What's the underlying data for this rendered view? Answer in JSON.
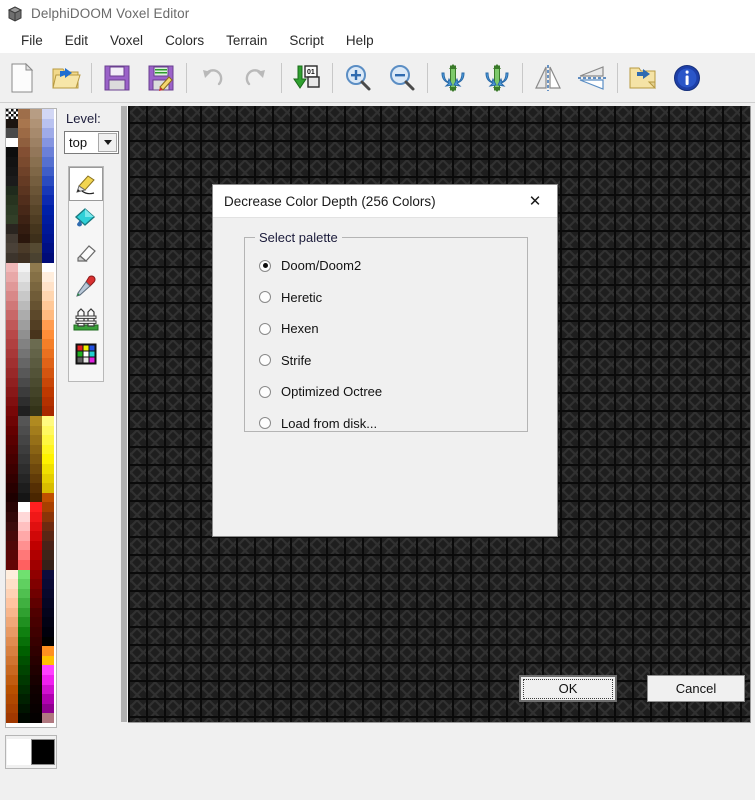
{
  "window": {
    "title": "DelphiDOOM Voxel Editor",
    "icon": "cube-icon"
  },
  "menubar": {
    "items": [
      {
        "label": "File"
      },
      {
        "label": "Edit"
      },
      {
        "label": "Voxel"
      },
      {
        "label": "Colors"
      },
      {
        "label": "Terrain"
      },
      {
        "label": "Script"
      },
      {
        "label": "Help"
      }
    ]
  },
  "toolbar": {
    "buttons": [
      {
        "name": "new-file-icon",
        "tooltip": "New"
      },
      {
        "name": "open-file-icon",
        "tooltip": "Open"
      },
      {
        "name": "save-icon",
        "tooltip": "Save"
      },
      {
        "name": "save-as-icon",
        "tooltip": "Save As"
      },
      {
        "name": "undo-icon",
        "tooltip": "Undo"
      },
      {
        "name": "redo-icon",
        "tooltip": "Redo"
      },
      {
        "name": "import-icon",
        "tooltip": "Import"
      },
      {
        "name": "zoom-in-icon",
        "tooltip": "Zoom In"
      },
      {
        "name": "zoom-out-icon",
        "tooltip": "Zoom Out"
      },
      {
        "name": "flip-vertical-icon",
        "tooltip": "Flip Vertical"
      },
      {
        "name": "rotate-vertical-icon",
        "tooltip": "Rotate Vertical"
      },
      {
        "name": "mirror-horizontal-icon",
        "tooltip": "Mirror Horizontal"
      },
      {
        "name": "mirror-vertical-icon",
        "tooltip": "Mirror Vertical"
      },
      {
        "name": "export-icon",
        "tooltip": "Export"
      },
      {
        "name": "info-icon",
        "tooltip": "About"
      }
    ]
  },
  "sidebar": {
    "level": {
      "label": "Level:",
      "value": "top",
      "options": [
        "top"
      ]
    },
    "tools": [
      {
        "name": "pencil-tool",
        "selected": true
      },
      {
        "name": "fill-tool",
        "selected": false
      },
      {
        "name": "eraser-tool",
        "selected": false
      },
      {
        "name": "eyedropper-tool",
        "selected": false
      },
      {
        "name": "fence-tool",
        "selected": false
      },
      {
        "name": "palette-tool",
        "selected": false
      }
    ],
    "swatches": {
      "foreground": "#ffffff",
      "background": "#000000"
    },
    "palette_colors": [
      "#transparent",
      "#9e6e4a",
      "#b79d84",
      "#d2d7f5",
      "#1b1410",
      "#a8764e",
      "#b09376",
      "#b9c2f0",
      "#4a4a4a",
      "#9c6a45",
      "#a78a6d",
      "#9fabe8",
      "#ffffff",
      "#8f5f3e",
      "#9d8164",
      "#8595e0",
      "#0d0d0d",
      "#834f33",
      "#93775a",
      "#6b80d8",
      "#121212",
      "#7a4a2e",
      "#897050",
      "#5570d0",
      "#161616",
      "#6f4229",
      "#7f6747",
      "#3f5ec8",
      "#1b1b1b",
      "#653b24",
      "#755e3f",
      "#2a4bc0",
      "#1f2a1c",
      "#5b3520",
      "#6b5537",
      "#1838b8",
      "#27331f",
      "#512e1c",
      "#624d31",
      "#0c2ab0",
      "#2c3a24",
      "#472818",
      "#584529",
      "#0020a8",
      "#323f28",
      "#3d2214",
      "#4f3d23",
      "#001ca0",
      "#2a2520",
      "#331c10",
      "#45351d",
      "#001898",
      "#423a32",
      "#2a160c",
      "#3d2f1a",
      "#001490",
      "#4a4138",
      "#4a3a28",
      "#554a32",
      "#001084",
      "#3c342c",
      "#3e3022",
      "#4a4230",
      "#000c78",
      "#f0b8b8",
      "#f2f2f2",
      "#8f7a4e",
      "#ffffff",
      "#e8a8a8",
      "#e4e4e4",
      "#857046",
      "#ffeedd",
      "#e09898",
      "#d6d6d6",
      "#7a663f",
      "#ffe2c8",
      "#d88888",
      "#c8c8c8",
      "#705c38",
      "#ffd6b0",
      "#d07878",
      "#bababa",
      "#665231",
      "#ffc898",
      "#c86868",
      "#acacac",
      "#5c482a",
      "#ff b a80",
      "#c05858",
      "#9e9e9e",
      "#523e23",
      "#ff9c50",
      "#b84848",
      "#909090",
      "#48341c",
      "#ff8e38",
      "#b04040",
      "#828282",
      "#6b6b50",
      "#f57f28",
      "#a83838",
      "#747474",
      "#636348",
      "#ea7120",
      "#a03030",
      "#666666",
      "#5b5b40",
      "#df6318",
      "#982828",
      "#585858",
      "#535338",
      "#d45510",
      "#902020",
      "#4a4a4a",
      "#4b4b30",
      "#c94708",
      "#881818",
      "#3c3c3c",
      "#434328",
      "#be3900",
      "#801010",
      "#2e2e2e",
      "#3b3b20",
      "#b33100",
      "#780808",
      "#202020",
      "#333318",
      "#a82900",
      "#6e0404",
      "#555555",
      "#b08a20",
      "#fffa80",
      "#640000",
      "#4d4d4d",
      "#a37d1c",
      "#fff860",
      "#5a0000",
      "#454545",
      "#967018",
      "#fff640",
      "#500000",
      "#3d3d3d",
      "#896314",
      "#fff420",
      "#460000",
      "#353535",
      "#7c5610",
      "#fff200",
      "#3c0000",
      "#2d2d2d",
      "#6f490c",
      "#f0e000",
      "#320000",
      "#252525",
      "#623c08",
      "#e4ce00",
      "#280000",
      "#1d1d1d",
      "#552f04",
      "#d8bc00",
      "#1e0000",
      "#151515",
      "#4a2600",
      "#c05000",
      "#280404",
      "#ffffff",
      "#ff2020",
      "#a84000",
      "#320808",
      "#ffd8d8",
      "#f01818",
      "#8a3408",
      "#3c0c0c",
      "#ffc0c0",
      "#e01010",
      "#6e2a10",
      "#460a0a",
      "#ffa8a8",
      "#d00808",
      "#5a2614",
      "#500808",
      "#ff9090",
      "#c00000",
      "#4a2218",
      "#5a0606",
      "#ff7878",
      "#b00000",
      "#3e2418",
      "#640404",
      "#ff6060",
      "#a00000",
      "#342018",
      "#ffeedd",
      "#70e070",
      "#900000",
      "#0c0c3c",
      "#ffe0c8",
      "#60d060",
      "#800000",
      "#0a0a34",
      "#ffd2b4",
      "#50c050",
      "#700000",
      "#08082c",
      "#ffc4a0",
      "#40b040",
      "#600000",
      "#060624",
      "#f8b68c",
      "#30a030",
      "#500000",
      "#04041c",
      "#f0a878",
      "#209020",
      "#480000",
      "#020214",
      "#e89a64",
      "#108010",
      "#400000",
      "#00000c",
      "#e08c50",
      "#087008",
      "#380000",
      "#000000",
      "#d88040",
      "#006000",
      "#300000",
      "#ff9020",
      "#d07430",
      "#005000",
      "#280000",
      "#ffc000",
      "#c86820",
      "#004400",
      "#200000",
      "#ff40ff",
      "#c05c10",
      "#003800",
      "#180000",
      "#f020f0",
      "#b85000",
      "#002c00",
      "#100000",
      "#d010d0",
      "#b04800",
      "#002000",
      "#0c0000",
      "#b000b0",
      "#a84000",
      "#001400",
      "#080000",
      "#900090",
      "#a03800",
      "#000800",
      "#040000",
      "#b07880"
    ]
  },
  "canvas": {
    "name": "voxel-grid-canvas"
  },
  "dialog": {
    "title": "Decrease Color Depth (256 Colors)",
    "close_label": "✕",
    "groupbox_title": "Select palette",
    "options": [
      {
        "label": "Doom/Doom2",
        "selected": true
      },
      {
        "label": "Heretic",
        "selected": false
      },
      {
        "label": "Hexen",
        "selected": false
      },
      {
        "label": "Strife",
        "selected": false
      },
      {
        "label": "Optimized Octree",
        "selected": false
      },
      {
        "label": "Load from disk...",
        "selected": false
      }
    ],
    "ok_label": "OK",
    "cancel_label": "Cancel"
  }
}
